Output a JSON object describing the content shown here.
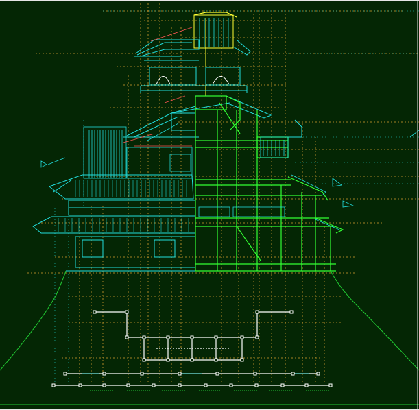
{
  "viewport": {
    "background": "#042604",
    "frame_color": "#e6e6e6"
  },
  "drawing": {
    "subject": "pagoda-cross-section-elevation",
    "layers": [
      {
        "name": "elevation-outline",
        "color": "#22dddd"
      },
      {
        "name": "structural-section",
        "color": "#33ff33"
      },
      {
        "name": "roof-ridge-detail",
        "color": "#ffff33"
      },
      {
        "name": "dimension-lines",
        "color": "#d8a030"
      },
      {
        "name": "site-slope",
        "color": "#22cc33"
      },
      {
        "name": "foundation-plan",
        "color": "#ffffff"
      },
      {
        "name": "annotation-leaders",
        "color": "#ff5555"
      }
    ]
  }
}
